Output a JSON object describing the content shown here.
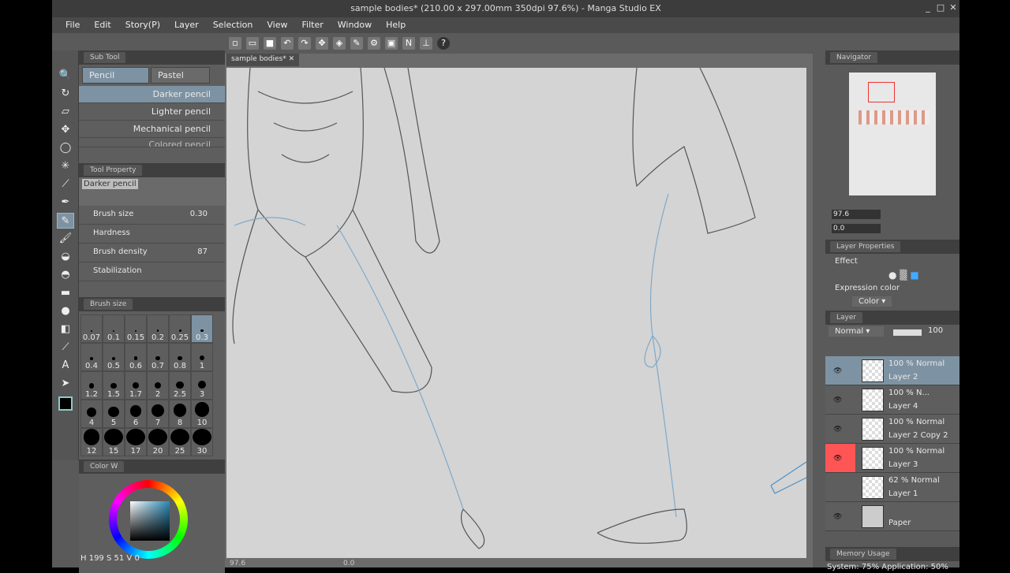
{
  "title": "sample bodies* (210.00 x 297.00mm 350dpi 97.6%) - Manga Studio EX",
  "menu": [
    "File",
    "Edit",
    "Story(P)",
    "Layer",
    "Selection",
    "View",
    "Filter",
    "Window",
    "Help"
  ],
  "doc_tab": "sample bodies*",
  "subtool": {
    "header": "Sub Tool",
    "groups": [
      "Pencil",
      "Pastel"
    ],
    "brushes": [
      "Darker pencil",
      "Lighter pencil",
      "Mechanical pencil",
      "Colored pencil"
    ]
  },
  "tool_property": {
    "header": "Tool Property",
    "name": "Darker pencil",
    "brush_size_label": "Brush size",
    "brush_size": "0.30",
    "hardness_label": "Hardness",
    "density_label": "Brush density",
    "density": "87",
    "stabilization_label": "Stabilization"
  },
  "brush_size_panel": {
    "header": "Brush size",
    "sizes": [
      "0.07",
      "0.1",
      "0.15",
      "0.2",
      "0.25",
      "0.3",
      "0.4",
      "0.5",
      "0.6",
      "0.7",
      "0.8",
      "1",
      "1.2",
      "1.5",
      "1.7",
      "2",
      "2.5",
      "3",
      "4",
      "5",
      "6",
      "7",
      "8",
      "10",
      "12",
      "15",
      "17",
      "20",
      "25",
      "30"
    ],
    "selected": "0.3"
  },
  "color": {
    "header": "Color W",
    "h": "199",
    "s": "51",
    "v": "0",
    "accent": "#2a8ab5"
  },
  "navigator": {
    "header": "Navigator",
    "zoom": "97.6",
    "rotation": "0.0"
  },
  "layer_properties": {
    "header": "Layer Properties",
    "effect": "Effect",
    "expression_label": "Expression color",
    "expression_value": "Color"
  },
  "layer_panel": {
    "header": "Layer",
    "blend": "Normal",
    "opacity": "100",
    "layers": [
      {
        "mode": "100 %  Normal",
        "name": "Layer 2"
      },
      {
        "mode": "100 %  N...",
        "name": "Layer 4"
      },
      {
        "mode": "100 %  Normal",
        "name": "Layer 2 Copy 2"
      },
      {
        "mode": "100 %  Normal",
        "name": "Layer 3"
      },
      {
        "mode": "62 %  Normal",
        "name": "Layer 1"
      },
      {
        "mode": "",
        "name": "Paper"
      }
    ]
  },
  "memory": {
    "header": "Memory Usage",
    "status": "System: 75%   Application: 50%"
  },
  "canvas_status": {
    "zoom": "97.6",
    "rotation": "0.0"
  }
}
